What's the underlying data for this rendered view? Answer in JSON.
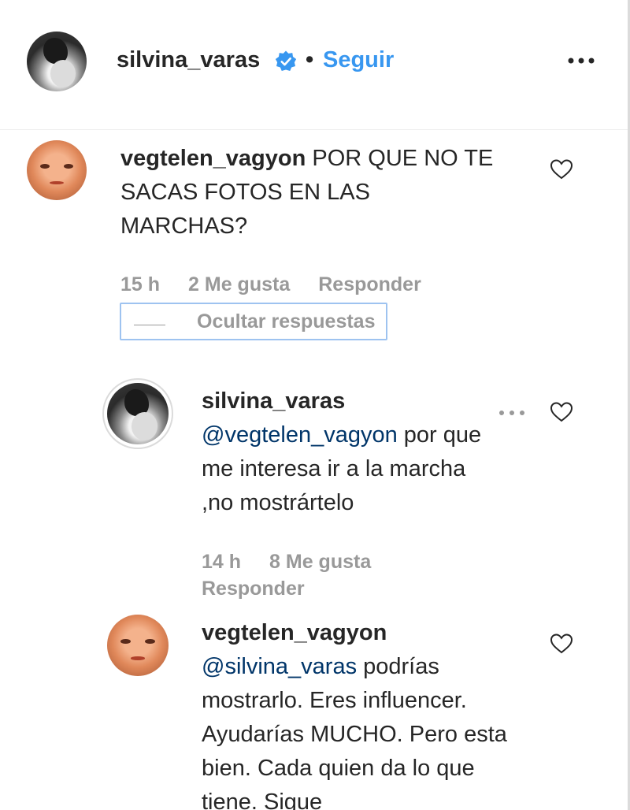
{
  "header": {
    "username": "silvina_varas",
    "separator": "•",
    "follow_label": "Seguir",
    "more_icon": "more-horizontal-icon",
    "verified_icon": "verified-badge-icon",
    "accent_color": "#3897f0"
  },
  "comments": [
    {
      "username": "vegtelen_vagyon",
      "text": "POR QUE NO TE SACAS FOTOS EN LAS MARCHAS?",
      "time": "15 h",
      "likes": "2 Me gusta",
      "reply_label": "Responder",
      "hide_replies_label": "Ocultar respuestas"
    }
  ],
  "replies": [
    {
      "username": "silvina_varas",
      "mention": "@vegtelen_vagyon",
      "text": "por que me interesa ir a la marcha ,no mostrártelo",
      "time": "14 h",
      "likes": "8 Me gusta",
      "reply_label": "Responder"
    },
    {
      "username": "vegtelen_vagyon",
      "mention": "@silvina_varas",
      "text": "podrías mostrarlo. Eres influencer. Ayudarías MUCHO. Pero esta bien. Cada quien da lo que tiene. Sigue"
    }
  ]
}
